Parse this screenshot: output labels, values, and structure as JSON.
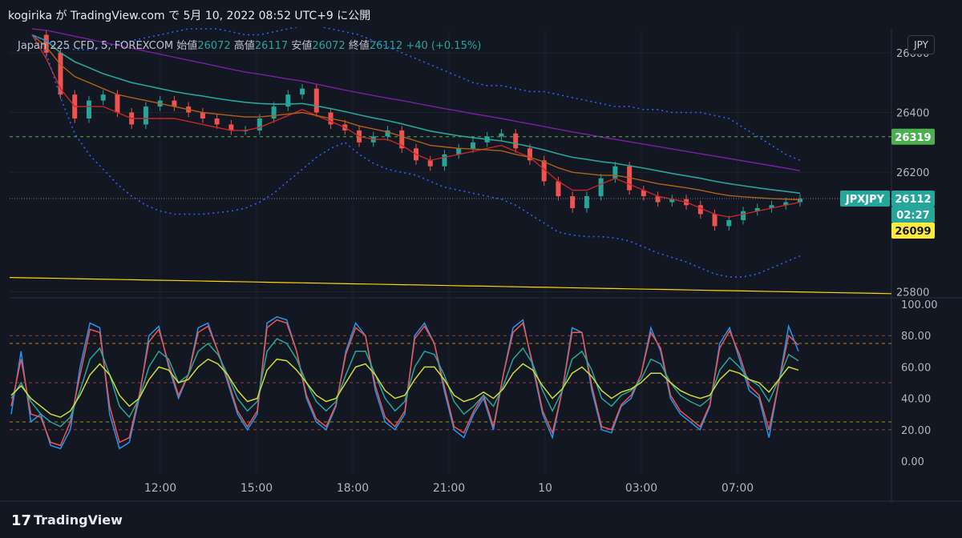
{
  "header": {
    "text": "kogirika が TradingView.com で 5月 10, 2022 08:52 UTC+9 に公開"
  },
  "legend": {
    "symbol": "Japan 225 CFD, 5, FOREXCOM",
    "open_label": "始値",
    "open": "26072",
    "high_label": "高値",
    "high": "26117",
    "low_label": "安値",
    "low": "26072",
    "close_label": "終値",
    "close": "26112",
    "change": "+40 (+0.15%)"
  },
  "currency_button": "JPY",
  "footer": {
    "logo": "17",
    "brand": "TradingView"
  },
  "colors": {
    "up": "#26a69a",
    "down": "#ef5350",
    "grid": "#1e222d",
    "teal_ma": "#26a69a",
    "orange_ma": "#b35f18",
    "red_ma": "#c62828",
    "purple_ma": "#7b1fa2",
    "bollinger": "#2962ff",
    "yellow": "#ffd600",
    "green_label": "#4caf50",
    "yellow_label": "#ffeb3b"
  },
  "chart_data": [
    {
      "type": "line",
      "subtype": "candlestick-with-indicators",
      "x_tick_labels": [
        "12:00",
        "15:00",
        "18:00",
        "21:00",
        "10",
        "03:00",
        "07:00"
      ],
      "y_tick_labels": [
        "26600",
        "26400",
        "26200",
        "25800"
      ],
      "ylim": [
        25780,
        26680
      ],
      "price_labels": [
        {
          "text": "26319",
          "value": 26319,
          "color": "#4caf50"
        },
        {
          "text": "JPXJPY",
          "value": 26112,
          "color": "#26a69a"
        },
        {
          "text": "26112",
          "value": 26112,
          "color": "#26a69a"
        },
        {
          "text": "02:27",
          "value": 26080,
          "color": "#26a69a"
        },
        {
          "text": "26099",
          "value": 26099,
          "color": "#ffeb3b"
        }
      ],
      "series": [
        {
          "values": [
            26660,
            26600,
            26460,
            26380,
            26440,
            26460,
            26400,
            26360,
            26420,
            26440,
            26420,
            26400,
            26380,
            26360,
            26340,
            26340,
            26380,
            26420,
            26460,
            26480,
            26400,
            26360,
            26340,
            26300,
            26320,
            26340,
            26280,
            26240,
            26220,
            26260,
            26280,
            26300,
            26320,
            26330,
            26280,
            26240,
            26170,
            26120,
            26080,
            26120,
            26180,
            26220,
            26140,
            26120,
            26100,
            26110,
            26090,
            26060,
            26020,
            26040,
            26070,
            26080,
            26090,
            26100,
            26112
          ]
        },
        {
          "values": [
            26660,
            26580,
            26480,
            26420,
            26420,
            26420,
            26400,
            26380,
            26380,
            26380,
            26380,
            26370,
            26360,
            26350,
            26340,
            26340,
            26350,
            26370,
            26390,
            26410,
            26390,
            26370,
            26350,
            26320,
            26310,
            26310,
            26290,
            26260,
            26240,
            26250,
            26260,
            26270,
            26280,
            26290,
            26270,
            26250,
            26210,
            26170,
            26140,
            26140,
            26160,
            26180,
            26160,
            26140,
            26120,
            26110,
            26100,
            26080,
            26060,
            26050,
            26060,
            26070,
            26080,
            26090,
            26100
          ]
        },
        {
          "values": [
            26660,
            26620,
            26560,
            26520,
            26500,
            26480,
            26460,
            26450,
            26440,
            26430,
            26420,
            26410,
            26400,
            26395,
            26390,
            26385,
            26385,
            26390,
            26395,
            26400,
            26390,
            26380,
            26370,
            26355,
            26345,
            26335,
            26320,
            26305,
            26290,
            26285,
            26280,
            26278,
            26275,
            26272,
            26260,
            26250,
            26235,
            26215,
            26200,
            26195,
            26190,
            26190,
            26182,
            26172,
            26162,
            26155,
            26148,
            26140,
            26130,
            26122,
            26118,
            26115,
            26112,
            26110,
            26108
          ]
        },
        {
          "values": [
            26660,
            26640,
            26600,
            26570,
            26550,
            26530,
            26515,
            26500,
            26490,
            26480,
            26470,
            26462,
            26455,
            26447,
            26440,
            26434,
            26430,
            26428,
            26428,
            26430,
            26422,
            26413,
            26403,
            26392,
            26382,
            26373,
            26362,
            26350,
            26338,
            26330,
            26322,
            26316,
            26310,
            26305,
            26296,
            26286,
            26275,
            26262,
            26250,
            26243,
            26236,
            26230,
            26222,
            26214,
            26205,
            26196,
            26188,
            26180,
            26170,
            26162,
            26155,
            26148,
            26142,
            26136,
            26130
          ]
        },
        {
          "values": [
            26680,
            26675,
            26665,
            26655,
            26645,
            26635,
            26625,
            26615,
            26605,
            26595,
            26585,
            26575,
            26565,
            26555,
            26545,
            26535,
            26528,
            26520,
            26512,
            26505,
            26495,
            26485,
            26475,
            26466,
            26457,
            26448,
            26440,
            26431,
            26422,
            26413,
            26405,
            26396,
            26388,
            26380,
            26371,
            26362,
            26353,
            26344,
            26335,
            26327,
            26318,
            26310,
            26302,
            26294,
            26286,
            26278,
            26270,
            26262,
            26254,
            26246,
            26238,
            26230,
            26222,
            26214,
            26205
          ]
        },
        {
          "values": [
            26660,
            26640,
            26620,
            26610,
            26610,
            26620,
            26630,
            26640,
            26650,
            26660,
            26670,
            26680,
            26680,
            26680,
            26670,
            26660,
            26660,
            26670,
            26680,
            26690,
            26690,
            26680,
            26670,
            26660,
            26640,
            26620,
            26600,
            26580,
            26560,
            26540,
            26520,
            26500,
            26490,
            26490,
            26480,
            26470,
            26470,
            26460,
            26450,
            26440,
            26430,
            26420,
            26420,
            26410,
            26410,
            26400,
            26400,
            26400,
            26390,
            26380,
            26350,
            26320,
            26290,
            26260,
            26240
          ]
        },
        {
          "values": [
            26660,
            26600,
            26450,
            26330,
            26260,
            26210,
            26160,
            26120,
            26090,
            26070,
            26060,
            26060,
            26060,
            26065,
            26070,
            26080,
            26100,
            26130,
            26170,
            26210,
            26250,
            26280,
            26300,
            26260,
            26230,
            26210,
            26200,
            26190,
            26170,
            26150,
            26140,
            26130,
            26120,
            26110,
            26090,
            26060,
            26030,
            26000,
            25990,
            25985,
            25985,
            25980,
            25970,
            25950,
            25930,
            25915,
            25900,
            25880,
            25860,
            25850,
            25850,
            25860,
            25880,
            25900,
            25920
          ]
        },
        {
          "values": [
            25848,
            25847,
            25846,
            25845,
            25844,
            25843,
            25842,
            25841,
            25840,
            25839,
            25838,
            25837,
            25836,
            25835,
            25834,
            25833,
            25832,
            25831,
            25830,
            25829,
            25828,
            25827,
            25826,
            25825,
            25824,
            25823,
            25822,
            25821,
            25820,
            25819,
            25818,
            25817,
            25816,
            25815,
            25814,
            25813,
            25812,
            25811,
            25810,
            25809,
            25808,
            25807,
            25806,
            25805,
            25804,
            25803,
            25802,
            25801,
            25800,
            25799,
            25798,
            25797,
            25796,
            25795,
            25794
          ]
        }
      ]
    },
    {
      "type": "line",
      "subtype": "oscillator",
      "y_tick_labels": [
        "100.00",
        "80.00",
        "60.00",
        "40.00",
        "20.00",
        "0.00"
      ],
      "ylim": [
        0,
        100
      ],
      "levels": [
        {
          "value": 80,
          "color": "#ef5350"
        },
        {
          "value": 75,
          "color": "#ffd600"
        },
        {
          "value": 50,
          "color": "#ef5350"
        },
        {
          "value": 25,
          "color": "#ffd600"
        },
        {
          "value": 20,
          "color": "#ef5350"
        }
      ],
      "series": [
        {
          "values": [
            30,
            70,
            25,
            30,
            10,
            8,
            20,
            60,
            88,
            85,
            30,
            8,
            12,
            40,
            80,
            86,
            60,
            40,
            55,
            85,
            88,
            70,
            50,
            30,
            20,
            30,
            88,
            92,
            90,
            70,
            40,
            25,
            20,
            35,
            70,
            88,
            80,
            45,
            25,
            20,
            30,
            80,
            88,
            75,
            45,
            20,
            15,
            30,
            40,
            20,
            55,
            85,
            90,
            60,
            30,
            15,
            45,
            85,
            82,
            45,
            20,
            18,
            35,
            40,
            55,
            85,
            70,
            40,
            30,
            25,
            20,
            35,
            75,
            85,
            65,
            45,
            40,
            15,
            50,
            86,
            70
          ]
        },
        {
          "values": [
            35,
            65,
            30,
            28,
            12,
            10,
            25,
            55,
            84,
            82,
            35,
            12,
            15,
            42,
            76,
            84,
            62,
            42,
            55,
            82,
            86,
            70,
            52,
            32,
            22,
            32,
            85,
            90,
            88,
            70,
            42,
            27,
            22,
            36,
            68,
            85,
            80,
            48,
            28,
            22,
            32,
            78,
            86,
            75,
            48,
            22,
            18,
            32,
            42,
            22,
            55,
            82,
            88,
            62,
            32,
            18,
            45,
            82,
            82,
            48,
            22,
            20,
            36,
            42,
            55,
            82,
            72,
            42,
            32,
            27,
            22,
            36,
            72,
            83,
            68,
            48,
            42,
            20,
            50,
            80,
            74
          ]
        },
        {
          "values": [
            40,
            50,
            38,
            30,
            25,
            22,
            28,
            45,
            65,
            72,
            55,
            35,
            28,
            40,
            60,
            70,
            65,
            50,
            55,
            70,
            75,
            68,
            55,
            40,
            32,
            38,
            70,
            78,
            75,
            65,
            50,
            38,
            32,
            38,
            55,
            70,
            70,
            55,
            40,
            32,
            38,
            60,
            70,
            68,
            55,
            38,
            30,
            35,
            42,
            35,
            48,
            65,
            72,
            62,
            45,
            32,
            45,
            65,
            70,
            58,
            40,
            35,
            42,
            45,
            52,
            65,
            62,
            50,
            42,
            38,
            35,
            40,
            58,
            66,
            60,
            52,
            48,
            38,
            52,
            68,
            64
          ]
        },
        {
          "values": [
            42,
            48,
            40,
            35,
            30,
            28,
            32,
            42,
            55,
            62,
            55,
            42,
            35,
            40,
            52,
            60,
            58,
            50,
            52,
            60,
            65,
            62,
            55,
            45,
            38,
            40,
            58,
            65,
            64,
            58,
            50,
            42,
            38,
            40,
            50,
            60,
            62,
            55,
            45,
            40,
            42,
            52,
            60,
            60,
            52,
            42,
            38,
            40,
            44,
            40,
            46,
            56,
            62,
            58,
            48,
            40,
            46,
            56,
            60,
            54,
            45,
            40,
            44,
            46,
            50,
            56,
            56,
            50,
            45,
            42,
            40,
            42,
            52,
            58,
            56,
            52,
            50,
            44,
            52,
            60,
            58
          ]
        }
      ]
    }
  ]
}
